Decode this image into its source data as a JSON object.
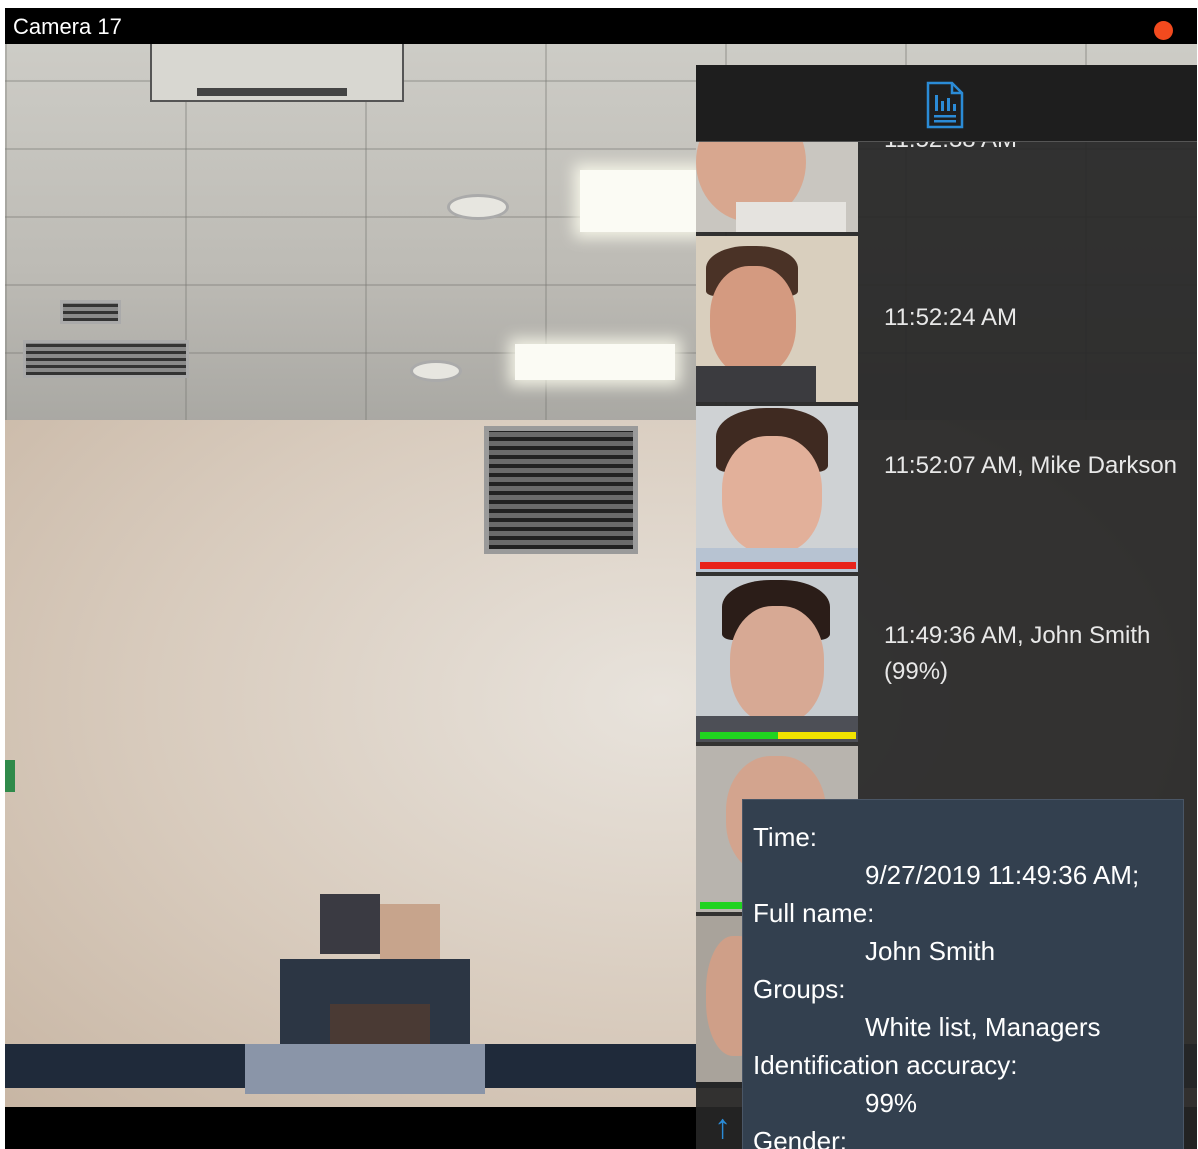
{
  "window": {
    "title": "Camera 17",
    "status": "recording",
    "status_color": "#f24a1e"
  },
  "panel": {
    "header_icon": "report-icon",
    "accent_color": "#2b8bd6",
    "events": [
      {
        "text": "11:52:38 AM",
        "accuracy": null
      },
      {
        "text": "11:52:24 AM",
        "accuracy": null
      },
      {
        "text": "11:52:07 AM, Mike Darkson",
        "bar": "red"
      },
      {
        "text": "11:49:36 AM, John Smith (99%)",
        "bar": "green-yellow"
      },
      {
        "text": "",
        "bar": "green"
      },
      {
        "text": "",
        "bar": null
      }
    ],
    "scroll_up_icon": "arrow-up-icon"
  },
  "tooltip": {
    "time_label": "Time:",
    "time_value": "9/27/2019 11:49:36 AM;",
    "name_label": "Full name:",
    "name_value": "John  Smith",
    "groups_label": "Groups:",
    "groups_value": "White list, Managers",
    "accuracy_label": "Identification accuracy:",
    "accuracy_value": "99%",
    "gender_label": "Gender:"
  },
  "colors": {
    "bar_red": "#e8231b",
    "bar_green": "#20d320",
    "bar_yellow": "#f0e200",
    "tooltip_bg": "#33404f"
  }
}
